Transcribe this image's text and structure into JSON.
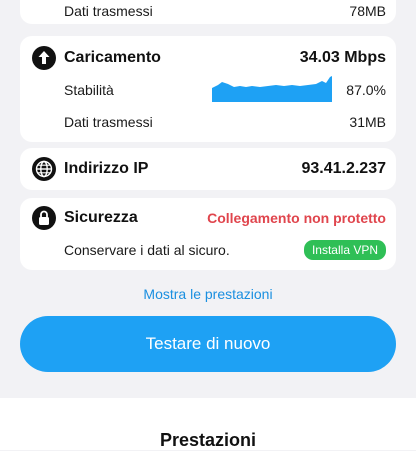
{
  "download": {
    "transfer_label": "Dati trasmessi",
    "transfer_value": "78MB"
  },
  "upload": {
    "title": "Caricamento",
    "speed": "34.03 Mbps",
    "stability_label": "Stabilità",
    "stability_value": "87.0%",
    "transfer_label": "Dati trasmessi",
    "transfer_value": "31MB",
    "icon": "upload-arrow-icon"
  },
  "ip": {
    "title": "Indirizzo IP",
    "value": "93.41.2.237",
    "icon": "globe-icon"
  },
  "security": {
    "title": "Sicurezza",
    "status": "Collegamento non protetto",
    "note": "Conservare i dati al sicuro.",
    "vpn_button": "Installa VPN",
    "icon": "lock-icon"
  },
  "performance_link": "Mostra le prestazioni",
  "retest_button": "Testare di nuovo",
  "bottom_title": "Prestazioni",
  "colors": {
    "accent": "#1ea1f4",
    "link": "#1a8fe0",
    "danger": "#e0454d",
    "success": "#2fbf56"
  }
}
